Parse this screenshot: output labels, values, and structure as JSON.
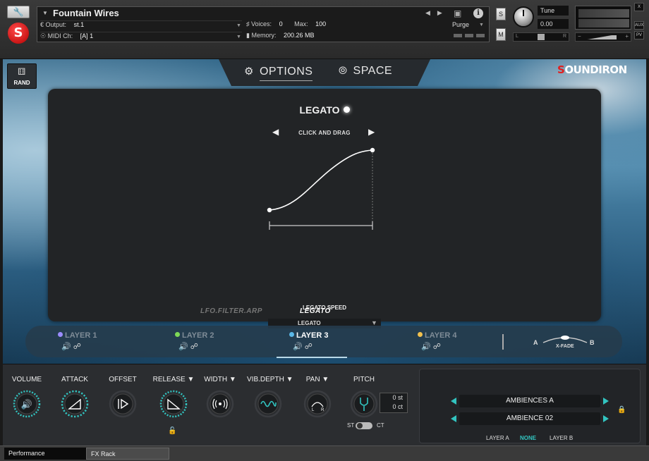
{
  "header": {
    "instrument_name": "Fountain Wires",
    "output_label": "Output:",
    "output_value": "st.1",
    "midi_label": "MIDI Ch:",
    "midi_value": "[A] 1",
    "voices_label": "Voices:",
    "voices_value": "0",
    "max_label": "Max:",
    "max_value": "100",
    "memory_label": "Memory:",
    "memory_value": "200.26 MB",
    "purge_label": "Purge",
    "solo_label": "S",
    "mute_label": "M",
    "tune_label": "Tune",
    "tune_value": "0.00",
    "pan_left": "L",
    "pan_right": "R",
    "vol_minus": "−",
    "vol_plus": "+",
    "side_buttons": [
      "X",
      "AUX",
      "PV"
    ]
  },
  "gui": {
    "rand_label": "RAND",
    "tabs": [
      {
        "label": "OPTIONS",
        "icon": "gear-icon",
        "active": true
      },
      {
        "label": "SPACE",
        "icon": "planet-icon",
        "active": false
      }
    ],
    "brand": {
      "prefix": "S",
      "rest": "OUNDIRON"
    },
    "legato": {
      "title": "LEGATO",
      "instruction": "CLICK AND DRAG",
      "speed_label": "LEGATO SPEED",
      "speed_value": "LEGATO",
      "modes": [
        "LFO.FILTER.ARP",
        "LEGATO"
      ],
      "active_mode": "LEGATO"
    },
    "layers": [
      {
        "label": "LAYER 1",
        "color": "#9b8cff",
        "active": false
      },
      {
        "label": "LAYER 2",
        "color": "#7ed957",
        "active": false
      },
      {
        "label": "LAYER 3",
        "color": "#5bb8e8",
        "active": true
      },
      {
        "label": "LAYER 4",
        "color": "#f2c14e",
        "active": false
      }
    ],
    "xfade": {
      "a": "A",
      "b": "B",
      "label": "X-FADE"
    }
  },
  "controls": {
    "knobs": [
      {
        "label": "VOLUME",
        "icon": "speaker-icon"
      },
      {
        "label": "ATTACK",
        "icon": "attack-ramp-icon"
      },
      {
        "label": "OFFSET",
        "icon": "offset-play-icon"
      },
      {
        "label": "RELEASE ▼",
        "icon": "release-ramp-icon"
      },
      {
        "label": "WIDTH ▼",
        "icon": "stereo-width-icon"
      },
      {
        "label": "VIB.DEPTH ▼",
        "icon": "vibrato-wave-icon"
      },
      {
        "label": "PAN ▼",
        "icon": "pan-lr-icon"
      },
      {
        "label": "PITCH",
        "icon": "tuning-fork-icon"
      }
    ],
    "pitch_st": "0 st",
    "pitch_ct": "0 ct",
    "st_label": "ST",
    "ct_label": "CT",
    "ambience_1": "AMBIENCES A",
    "ambience_2": "AMBIENCE 02",
    "layer_a": "LAYER A",
    "none": "NONE",
    "layer_b": "LAYER B"
  },
  "bottom_tabs": [
    "Performance",
    "FX Rack"
  ],
  "colors": {
    "accent": "#32c4c0",
    "brand_red": "#e21d1d"
  }
}
